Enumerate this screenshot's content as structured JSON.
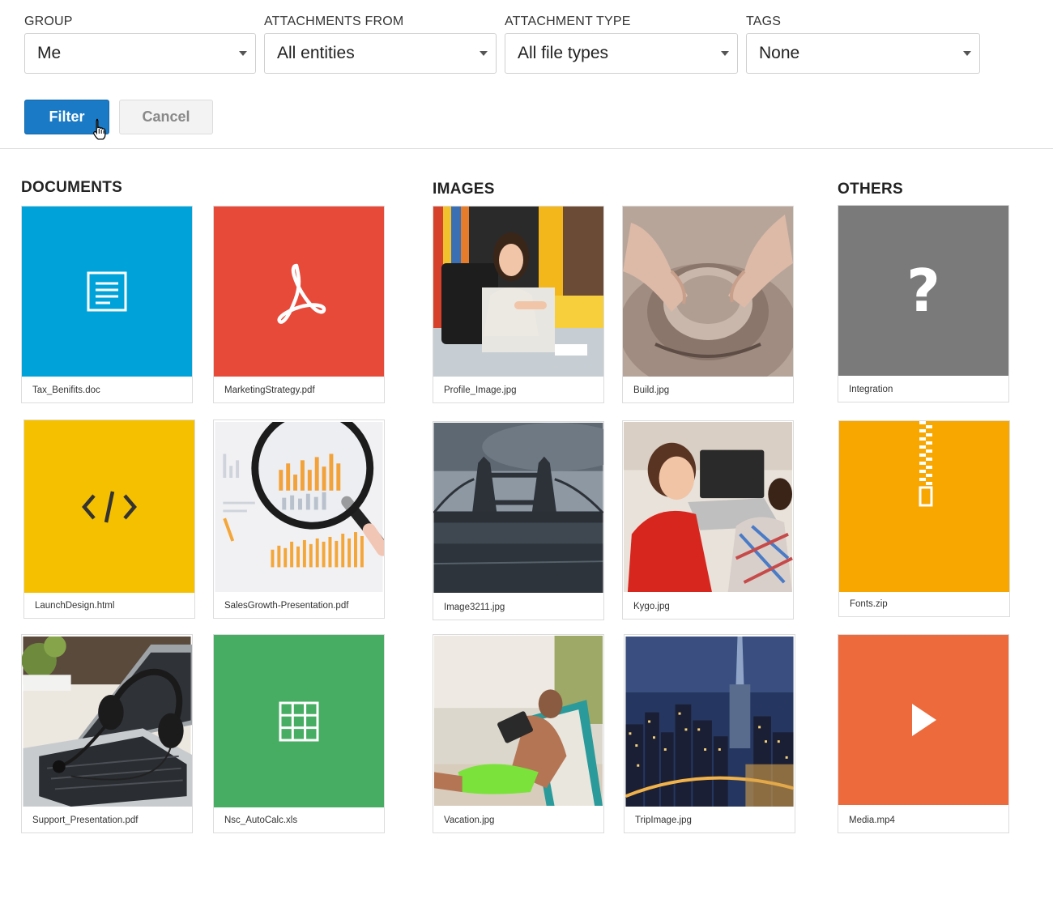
{
  "filters": {
    "group": {
      "label": "GROUP",
      "value": "Me"
    },
    "attachments_from": {
      "label": "ATTACHMENTS FROM",
      "value": "All entities"
    },
    "attachment_type": {
      "label": "ATTACHMENT TYPE",
      "value": "All file types"
    },
    "tags": {
      "label": "TAGS",
      "value": "None"
    }
  },
  "buttons": {
    "filter": "Filter",
    "cancel": "Cancel"
  },
  "sections": {
    "documents": "DOCUMENTS",
    "images": "IMAGES",
    "others": "OTHERS"
  },
  "documents": [
    {
      "name": "Tax_Benifits.doc",
      "icon": "document-icon",
      "color": "#00a3d9"
    },
    {
      "name": "MarketingStrategy.pdf",
      "icon": "acrobat-icon",
      "color": "#e84a3a"
    },
    {
      "name": "LaunchDesign.html",
      "icon": "code-icon",
      "color": "#f5c000"
    },
    {
      "name": "SalesGrowth-Presentation.pdf",
      "icon": "magnifier-photo"
    },
    {
      "name": "Support_Presentation.pdf",
      "icon": "headset-laptop-photo"
    },
    {
      "name": "Nsc_AutoCalc.xls",
      "icon": "spreadsheet-icon",
      "color": "#46ad62"
    }
  ],
  "images": [
    {
      "name": "Profile_Image.jpg",
      "icon": "woman-office-photo"
    },
    {
      "name": "Build.jpg",
      "icon": "pottery-photo"
    },
    {
      "name": "Image3211.jpg",
      "icon": "tower-bridge-photo"
    },
    {
      "name": "Kygo.jpg",
      "icon": "woman-laptop-photo"
    },
    {
      "name": "Vacation.jpg",
      "icon": "beach-tablet-photo"
    },
    {
      "name": "TripImage.jpg",
      "icon": "city-night-photo"
    }
  ],
  "others": [
    {
      "name": "Integration",
      "icon": "question-icon",
      "color": "#7a7a7a"
    },
    {
      "name": "Fonts.zip",
      "icon": "zip-icon",
      "color": "#f8a600"
    },
    {
      "name": "Media.mp4",
      "icon": "play-icon",
      "color": "#ec6a3b"
    }
  ]
}
